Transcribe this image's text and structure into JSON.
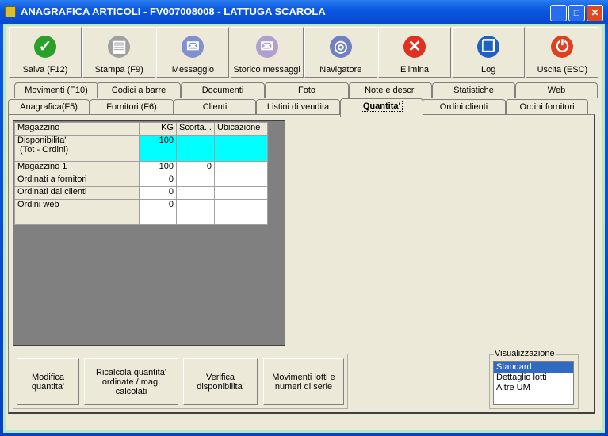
{
  "window": {
    "title": "ANAGRAFICA ARTICOLI - FV007008008 - LATTUGA SCAROLA"
  },
  "toolbar": [
    {
      "label": "Salva (F12)",
      "icon": "check-icon",
      "color": "#2aa02a"
    },
    {
      "label": "Stampa (F9)",
      "icon": "printer-icon",
      "color": "#a0a0a0"
    },
    {
      "label": "Messaggio",
      "icon": "envelope-pen-icon",
      "color": "#8090d0"
    },
    {
      "label": "Storico messaggi",
      "icon": "envelope-search-icon",
      "color": "#b0a0d0"
    },
    {
      "label": "Navigatore",
      "icon": "compass-icon",
      "color": "#7080c0"
    },
    {
      "label": "Elimina",
      "icon": "delete-x-icon",
      "color": "#e03020"
    },
    {
      "label": "Log",
      "icon": "log-book-icon",
      "color": "#2060c0"
    },
    {
      "label": "Uscita (ESC)",
      "icon": "power-icon",
      "color": "#e04020"
    }
  ],
  "tabs_row1": [
    "Movimenti (F10)",
    "Codici a barre",
    "Documenti",
    "Foto",
    "Note e descr.",
    "Statistiche",
    "Web"
  ],
  "tabs_row2": [
    "Anagrafica(F5)",
    "Fornitori (F6)",
    "Clienti",
    "Listini di vendita",
    "Quantita'",
    "Ordini clienti",
    "Ordini fornitori"
  ],
  "active_tab": "Quantita'",
  "grid": {
    "headers": [
      "Magazzino",
      "KG",
      "Scorta...",
      "Ubicazione"
    ],
    "rows": [
      {
        "name": "Disponibilita'",
        "name2": " (Tot - Ordini)",
        "kg": "100",
        "scorta": "",
        "ubicazione": ""
      },
      {
        "name": "Magazzino 1",
        "kg": "100",
        "scorta": "0",
        "ubicazione": ""
      },
      {
        "name": "Ordinati a fornitori",
        "kg": "0",
        "scorta": "",
        "ubicazione": ""
      },
      {
        "name": "Ordinati dai clienti",
        "kg": "0",
        "scorta": "",
        "ubicazione": ""
      },
      {
        "name": "Ordini web",
        "kg": "0",
        "scorta": "",
        "ubicazione": ""
      }
    ],
    "highlight_color": "#00ffff"
  },
  "actions": [
    "Modifica quantita'",
    "Ricalcola quantita' ordinate / mag. calcolati",
    "Verifica disponibilita'",
    "Movimenti lotti e numeri di serie"
  ],
  "view": {
    "label": "Visualizzazione",
    "options": [
      "Standard",
      "Dettaglio lotti",
      "Altre UM"
    ],
    "selected": "Standard"
  }
}
